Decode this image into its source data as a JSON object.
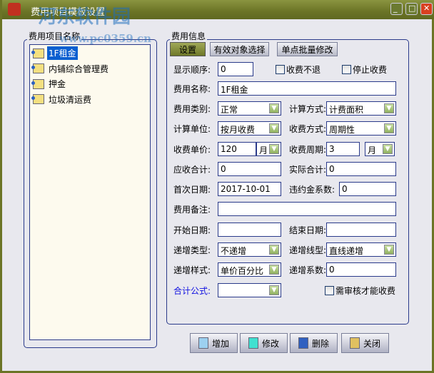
{
  "window": {
    "title": "费用项目模板设置",
    "watermark": "河东软件园",
    "watermark_url": "www.pc0359.cn",
    "minimize": "_",
    "maximize": "□",
    "close": "✕"
  },
  "left": {
    "group_label": "费用项目名称",
    "items": [
      "1F租金",
      "内铺综合管理费",
      "押金",
      "垃圾清运费"
    ],
    "selected": 0
  },
  "right": {
    "group_label": "费用信息",
    "tabs": [
      "设置",
      "有效对象选择",
      "单点批量修改"
    ],
    "active_tab": 0
  },
  "fields": {
    "display_order": {
      "label": "显示顺序:",
      "value": "0"
    },
    "no_refund": {
      "label": "收费不退",
      "checked": false
    },
    "stop_fee": {
      "label": "停止收费",
      "checked": false
    },
    "fee_name": {
      "label": "费用名称:",
      "value": "1F租金"
    },
    "fee_category": {
      "label": "费用类别:",
      "value": "正常"
    },
    "calc_method": {
      "label": "计算方式:",
      "value": "计费面积"
    },
    "calc_unit": {
      "label": "计算单位:",
      "value": "按月收费"
    },
    "charge_method": {
      "label": "收费方式:",
      "value": "周期性"
    },
    "unit_price": {
      "label": "收费单价:",
      "value": "120"
    },
    "unit_price_period": {
      "value": "月"
    },
    "charge_cycle": {
      "label": "收费周期:",
      "value": "3"
    },
    "charge_cycle_unit": {
      "value": "月"
    },
    "receivable_total": {
      "label": "应收合计:",
      "value": "0"
    },
    "actual_total": {
      "label": "实际合计:",
      "value": "0"
    },
    "first_date": {
      "label": "首次日期:",
      "value": "2017-10-01"
    },
    "penalty_rate": {
      "label": "违约金系数:",
      "value": "0"
    },
    "remark": {
      "label": "费用备注:",
      "value": ""
    },
    "start_date": {
      "label": "开始日期:",
      "value": ""
    },
    "end_date": {
      "label": "结束日期:",
      "value": ""
    },
    "increase_type": {
      "label": "递增类型:",
      "value": "不递增"
    },
    "increase_line": {
      "label": "递增线型:",
      "value": "直线递增"
    },
    "increase_style": {
      "label": "递增样式:",
      "value": "单价百分比"
    },
    "increase_rate": {
      "label": "递增系数:",
      "value": "0"
    },
    "total_formula": {
      "label": "合计公式:",
      "value": "",
      "label_color": "#1010e0"
    },
    "need_review": {
      "label": "需审核才能收费",
      "checked": false
    }
  },
  "buttons": {
    "add": "增加",
    "edit": "修改",
    "delete": "删除",
    "close": "关闭"
  }
}
